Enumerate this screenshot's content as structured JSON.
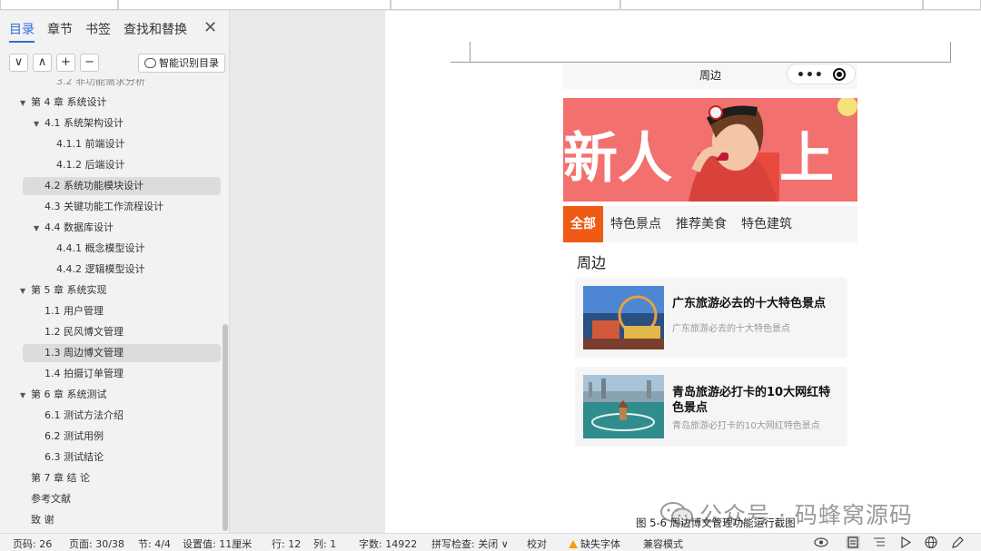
{
  "nav": {
    "tabs": [
      "目录",
      "章节",
      "书签",
      "查找和替换"
    ],
    "tools": [
      "∨",
      "∧",
      "+",
      "−"
    ],
    "smart_button": "智能识别目录",
    "toc": [
      {
        "label": "3.2  非功能需求分析",
        "level": 2,
        "arrow": false,
        "selected": false,
        "partial": true
      },
      {
        "label": "第 4 章  系统设计",
        "level": 0,
        "arrow": true,
        "selected": false
      },
      {
        "label": "4.1    系统架构设计",
        "level": 1,
        "arrow": true,
        "selected": false
      },
      {
        "label": "4.1.1   前端设计",
        "level": 2,
        "arrow": false,
        "selected": false
      },
      {
        "label": "4.1.2   后端设计",
        "level": 2,
        "arrow": false,
        "selected": false
      },
      {
        "label": "4.2    系统功能模块设计",
        "level": 1,
        "arrow": false,
        "selected": true
      },
      {
        "label": "4.3    关键功能工作流程设计",
        "level": 1,
        "arrow": false,
        "selected": false
      },
      {
        "label": "4.4    数据库设计",
        "level": 1,
        "arrow": true,
        "selected": false
      },
      {
        "label": "4.4.1   概念模型设计",
        "level": 2,
        "arrow": false,
        "selected": false
      },
      {
        "label": "4.4.2   逻辑模型设计",
        "level": 2,
        "arrow": false,
        "selected": false
      },
      {
        "label": "第 5 章  系统实现",
        "level": 0,
        "arrow": true,
        "selected": false
      },
      {
        "label": "1.1  用户管理",
        "level": 1,
        "arrow": false,
        "selected": false
      },
      {
        "label": "1.2  民风博文管理",
        "level": 1,
        "arrow": false,
        "selected": false
      },
      {
        "label": "1.3  周边博文管理",
        "level": 1,
        "arrow": false,
        "selected": true
      },
      {
        "label": "1.4  拍摄订单管理",
        "level": 1,
        "arrow": false,
        "selected": false
      },
      {
        "label": "第 6 章  系统测试",
        "level": 0,
        "arrow": true,
        "selected": false
      },
      {
        "label": "6.1    测试方法介绍",
        "level": 1,
        "arrow": false,
        "selected": false
      },
      {
        "label": "6.2    测试用例",
        "level": 1,
        "arrow": false,
        "selected": false
      },
      {
        "label": "6.3    测试结论",
        "level": 1,
        "arrow": false,
        "selected": false
      },
      {
        "label": "第 7 章    结      论",
        "level": 0,
        "arrow": false,
        "selected": false
      },
      {
        "label": "参考文献",
        "level": 0,
        "arrow": false,
        "selected": false
      },
      {
        "label": "致      谢",
        "level": 0,
        "arrow": false,
        "selected": false
      }
    ]
  },
  "phone": {
    "title": "周边",
    "banner_text_left": "新人",
    "banner_text_right": "上线",
    "categories": [
      "全部",
      "特色景点",
      "推荐美食",
      "特色建筑"
    ],
    "active_category": 0,
    "section_title": "周边",
    "cards": [
      {
        "title": "广东旅游必去的十大特色景点",
        "subtitle": "广东旅游必去的十大特色景点"
      },
      {
        "title": "青岛旅游必打卡的10大网红特色景点",
        "subtitle": "青岛旅游必打卡的10大网红特色景点"
      }
    ]
  },
  "caption": "图 5-6  周边博文管理功能运行截图",
  "watermark": "公众号 · 码蜂窝源码",
  "status": {
    "page_num": "页码: 26",
    "page": "页面: 30/38",
    "section": "节: 4/4",
    "setting": "设置值: 11厘米",
    "row": "行: 12",
    "col": "列: 1",
    "words": "字数: 14922",
    "spell": "拼写检查: 关闭 ∨",
    "proof": "校对",
    "missing_font": "缺失字体",
    "compat": "兼容模式"
  },
  "colors": {
    "accent": "#2b6ee0",
    "category_active": "#ef5b14",
    "banner": "#f2716e"
  }
}
